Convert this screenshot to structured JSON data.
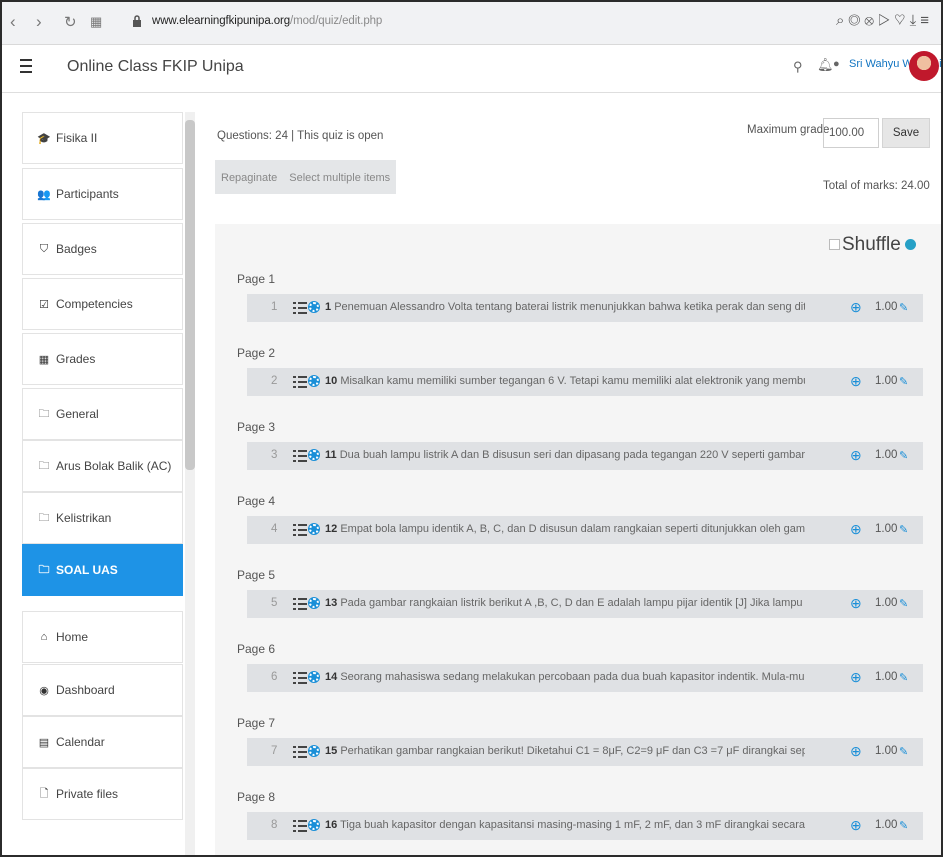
{
  "browser": {
    "url_domain": "www.elearningfkipunipa.org",
    "url_path": "/mod/quiz/edit.php"
  },
  "header": {
    "site_name": "Online Class FKIP Unipa",
    "user_name": "Sri Wahyu Widyaningsih"
  },
  "sidebar": {
    "items": [
      {
        "label": "Fisika II",
        "icon": "graduation-cap-icon",
        "glyph": "🎓"
      },
      {
        "label": "Participants",
        "icon": "users-icon",
        "glyph": "👥"
      },
      {
        "label": "Badges",
        "icon": "shield-icon",
        "glyph": "⛉"
      },
      {
        "label": "Competencies",
        "icon": "checkbox-icon",
        "glyph": "☑"
      },
      {
        "label": "Grades",
        "icon": "table-icon",
        "glyph": "▦"
      },
      {
        "label": "General",
        "icon": "folder-icon",
        "glyph": "🗀"
      },
      {
        "label": "Arus Bolak Balik (AC)",
        "icon": "folder-icon",
        "glyph": "🗀"
      },
      {
        "label": "Kelistrikan",
        "icon": "folder-icon",
        "glyph": "🗀"
      },
      {
        "label": "SOAL UAS",
        "icon": "folder-icon",
        "glyph": "🗀"
      },
      {
        "label": "Home",
        "icon": "home-icon",
        "glyph": "⌂"
      },
      {
        "label": "Dashboard",
        "icon": "dashboard-icon",
        "glyph": "◉"
      },
      {
        "label": "Calendar",
        "icon": "calendar-icon",
        "glyph": "▤"
      },
      {
        "label": "Private files",
        "icon": "file-icon",
        "glyph": "🗋"
      }
    ],
    "active_index": 8
  },
  "main": {
    "info": "Questions: 24 | This quiz is open",
    "max_grade_label": "Maximum grade",
    "max_grade_value": "100.00",
    "save_label": "Save",
    "repaginate_label": "Repaginate",
    "select_multiple_label": "Select multiple items",
    "total_marks": "Total of marks: 24.00",
    "shuffle_label": "Shuffle",
    "pages": [
      {
        "page": "Page 1",
        "slot": "1",
        "qnum": "1",
        "text": "Penemuan Alessandro Volta tentang baterai listrik menunjukkan bahwa ketika perak dan seng ditemp...",
        "mark": "1.00"
      },
      {
        "page": "Page 2",
        "slot": "2",
        "qnum": "10",
        "text": "Misalkan kamu memiliki sumber tegangan 6 V. Tetapi kamu memiliki alat elektronik yang membutuh...",
        "mark": "1.00"
      },
      {
        "page": "Page 3",
        "slot": "3",
        "qnum": "11",
        "text": "Dua buah lampu listrik A dan B disusun seri dan dipasang pada tegangan 220 V seperti gambar. Spe...",
        "mark": "1.00"
      },
      {
        "page": "Page 4",
        "slot": "4",
        "qnum": "12",
        "text": "Empat bola lampu identik A, B, C, dan D disusun dalam rangkaian seperti ditunjukkan oleh gambar b...",
        "mark": "1.00"
      },
      {
        "page": "Page 5",
        "slot": "5",
        "qnum": "13",
        "text": "Pada gambar rangkaian listrik berikut A ,B, C, D dan E adalah lampu pijar identik [J] Jika lampu B dile...",
        "mark": "1.00"
      },
      {
        "page": "Page 6",
        "slot": "6",
        "qnum": "14",
        "text": "Seorang mahasiswa sedang melakukan percobaan pada dua buah kapasitor indentik. Mula-mula ked...",
        "mark": "1.00"
      },
      {
        "page": "Page 7",
        "slot": "7",
        "qnum": "15",
        "text": "Perhatikan gambar rangkaian berikut! Diketahui  C1 = 8μF, C2=9 μF  dan C3 =7 μF dirangkai seperti ...",
        "mark": "1.00"
      },
      {
        "page": "Page 8",
        "slot": "8",
        "qnum": "16",
        "text": "Tiga buah kapasitor dengan kapasitansi masing-masing 1 mF, 2 mF, dan 3 mF dirangkai secara seri d...",
        "mark": "1.00"
      }
    ]
  }
}
